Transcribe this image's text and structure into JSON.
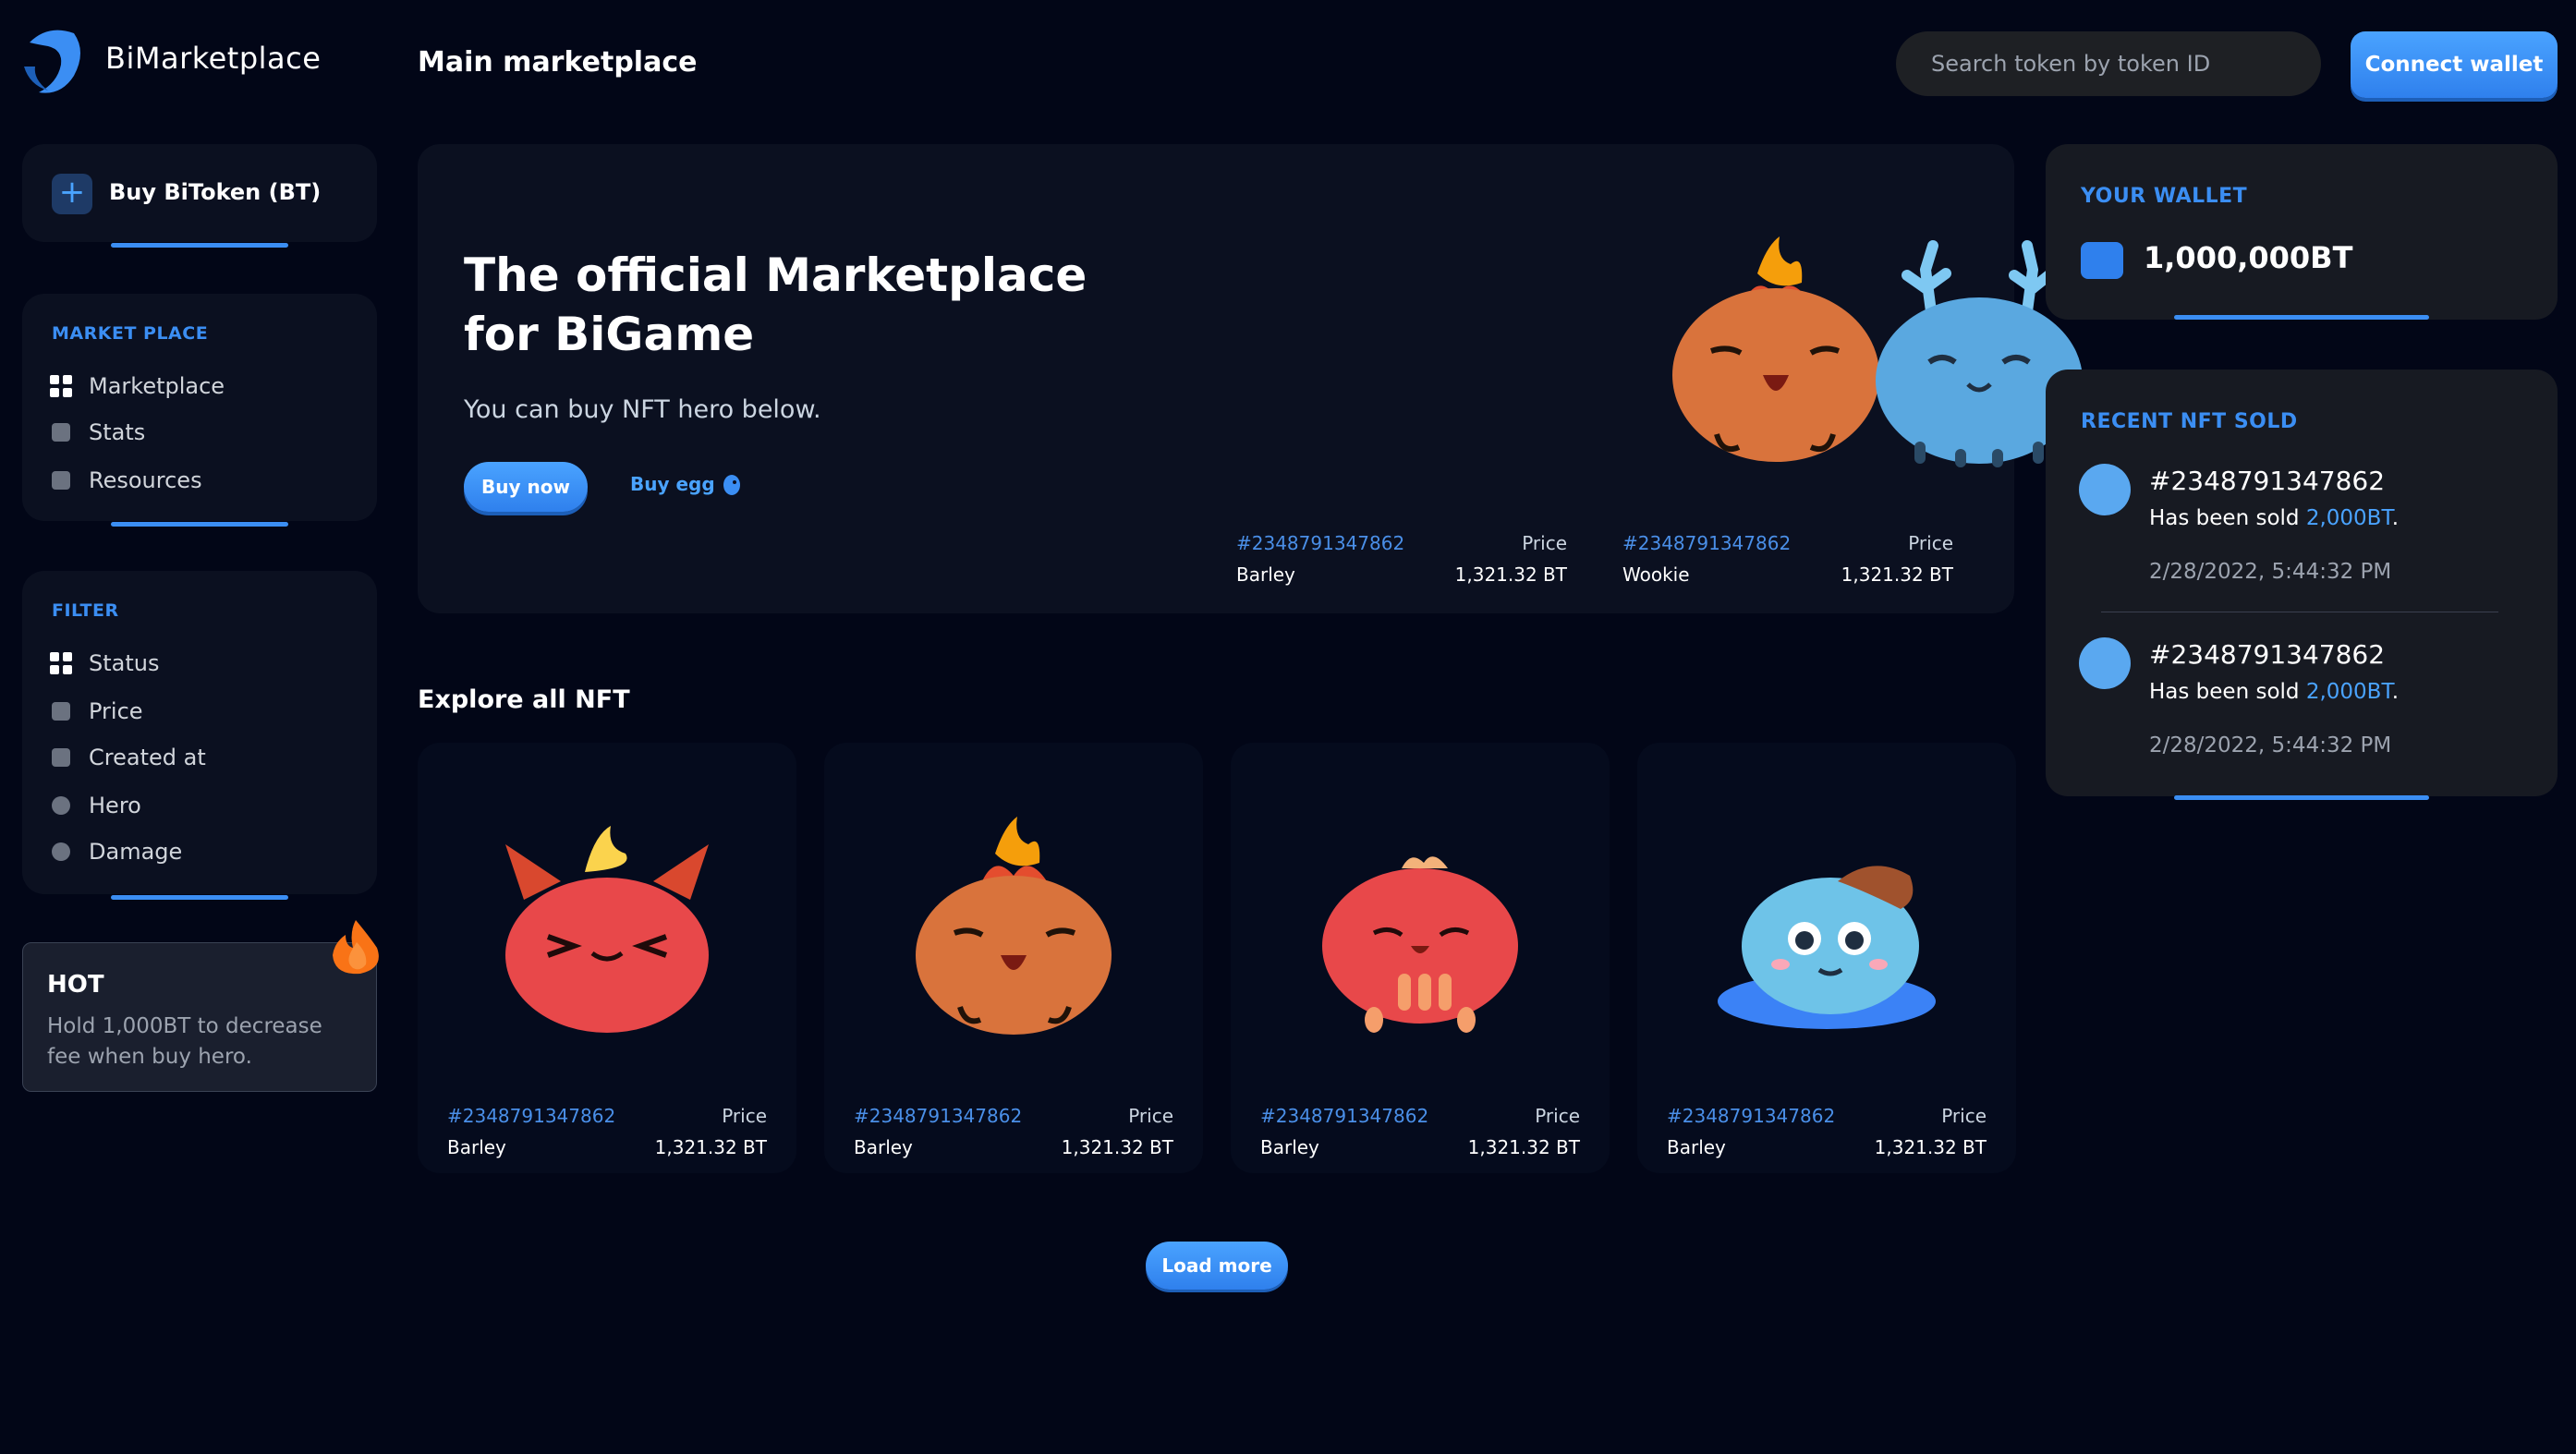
{
  "app": {
    "brand": "BiMarketplace",
    "page_title": "Main marketplace"
  },
  "header": {
    "search_placeholder": "Search token by token ID",
    "connect_label": "Connect wallet"
  },
  "sidebar": {
    "buy_label": "Buy BiToken (BT)",
    "marketplace_heading": "MARKET PLACE",
    "nav_items": [
      {
        "label": "Marketplace",
        "icon": "grid-icon"
      },
      {
        "label": "Stats",
        "icon": "stats-icon"
      },
      {
        "label": "Resources",
        "icon": "document-icon"
      }
    ],
    "filter_heading": "FILTER",
    "filter_items": [
      {
        "label": "Status",
        "icon": "grid-icon"
      },
      {
        "label": "Price",
        "icon": "stats-icon"
      },
      {
        "label": "Created at",
        "icon": "document-icon"
      },
      {
        "label": "Hero",
        "icon": "more-icon"
      },
      {
        "label": "Damage",
        "icon": "damage-icon"
      }
    ]
  },
  "hot": {
    "title": "HOT",
    "text": "Hold 1,000BT to decrease fee when buy hero."
  },
  "hero": {
    "title": "The official Marketplace for BiGame",
    "subtitle": "You can buy NFT hero below.",
    "buy_now": "Buy now",
    "buy_egg": "Buy egg",
    "featured": [
      {
        "id": "#2348791347862",
        "name": "Barley",
        "price_label": "Price",
        "price": "1,321.32 BT"
      },
      {
        "id": "#2348791347862",
        "name": "Wookie",
        "price_label": "Price",
        "price": "1,321.32 BT"
      }
    ]
  },
  "explore": {
    "title": "Explore all NFT",
    "cards": [
      {
        "id": "#2348791347862",
        "name": "Barley",
        "price_label": "Price",
        "price": "1,321.32 BT"
      },
      {
        "id": "#2348791347862",
        "name": "Barley",
        "price_label": "Price",
        "price": "1,321.32 BT"
      },
      {
        "id": "#2348791347862",
        "name": "Barley",
        "price_label": "Price",
        "price": "1,321.32 BT"
      },
      {
        "id": "#2348791347862",
        "name": "Barley",
        "price_label": "Price",
        "price": "1,321.32 BT"
      }
    ],
    "load_more": "Load more"
  },
  "wallet": {
    "heading": "YOUR WALLET",
    "amount": "1,000,000BT"
  },
  "recent": {
    "heading": "RECENT NFT SOLD",
    "items": [
      {
        "id": "#2348791347862",
        "text_prefix": "Has been sold ",
        "amount": "2,000BT",
        "text_suffix": ".",
        "time": "2/28/2022, 5:44:32 PM"
      },
      {
        "id": "#2348791347862",
        "text_prefix": "Has been sold ",
        "amount": "2,000BT",
        "text_suffix": ".",
        "time": "2/28/2022, 5:44:32 PM"
      }
    ]
  },
  "colors": {
    "background": "#020617",
    "accent": "#3b8ef3",
    "card": "#0b1020"
  }
}
